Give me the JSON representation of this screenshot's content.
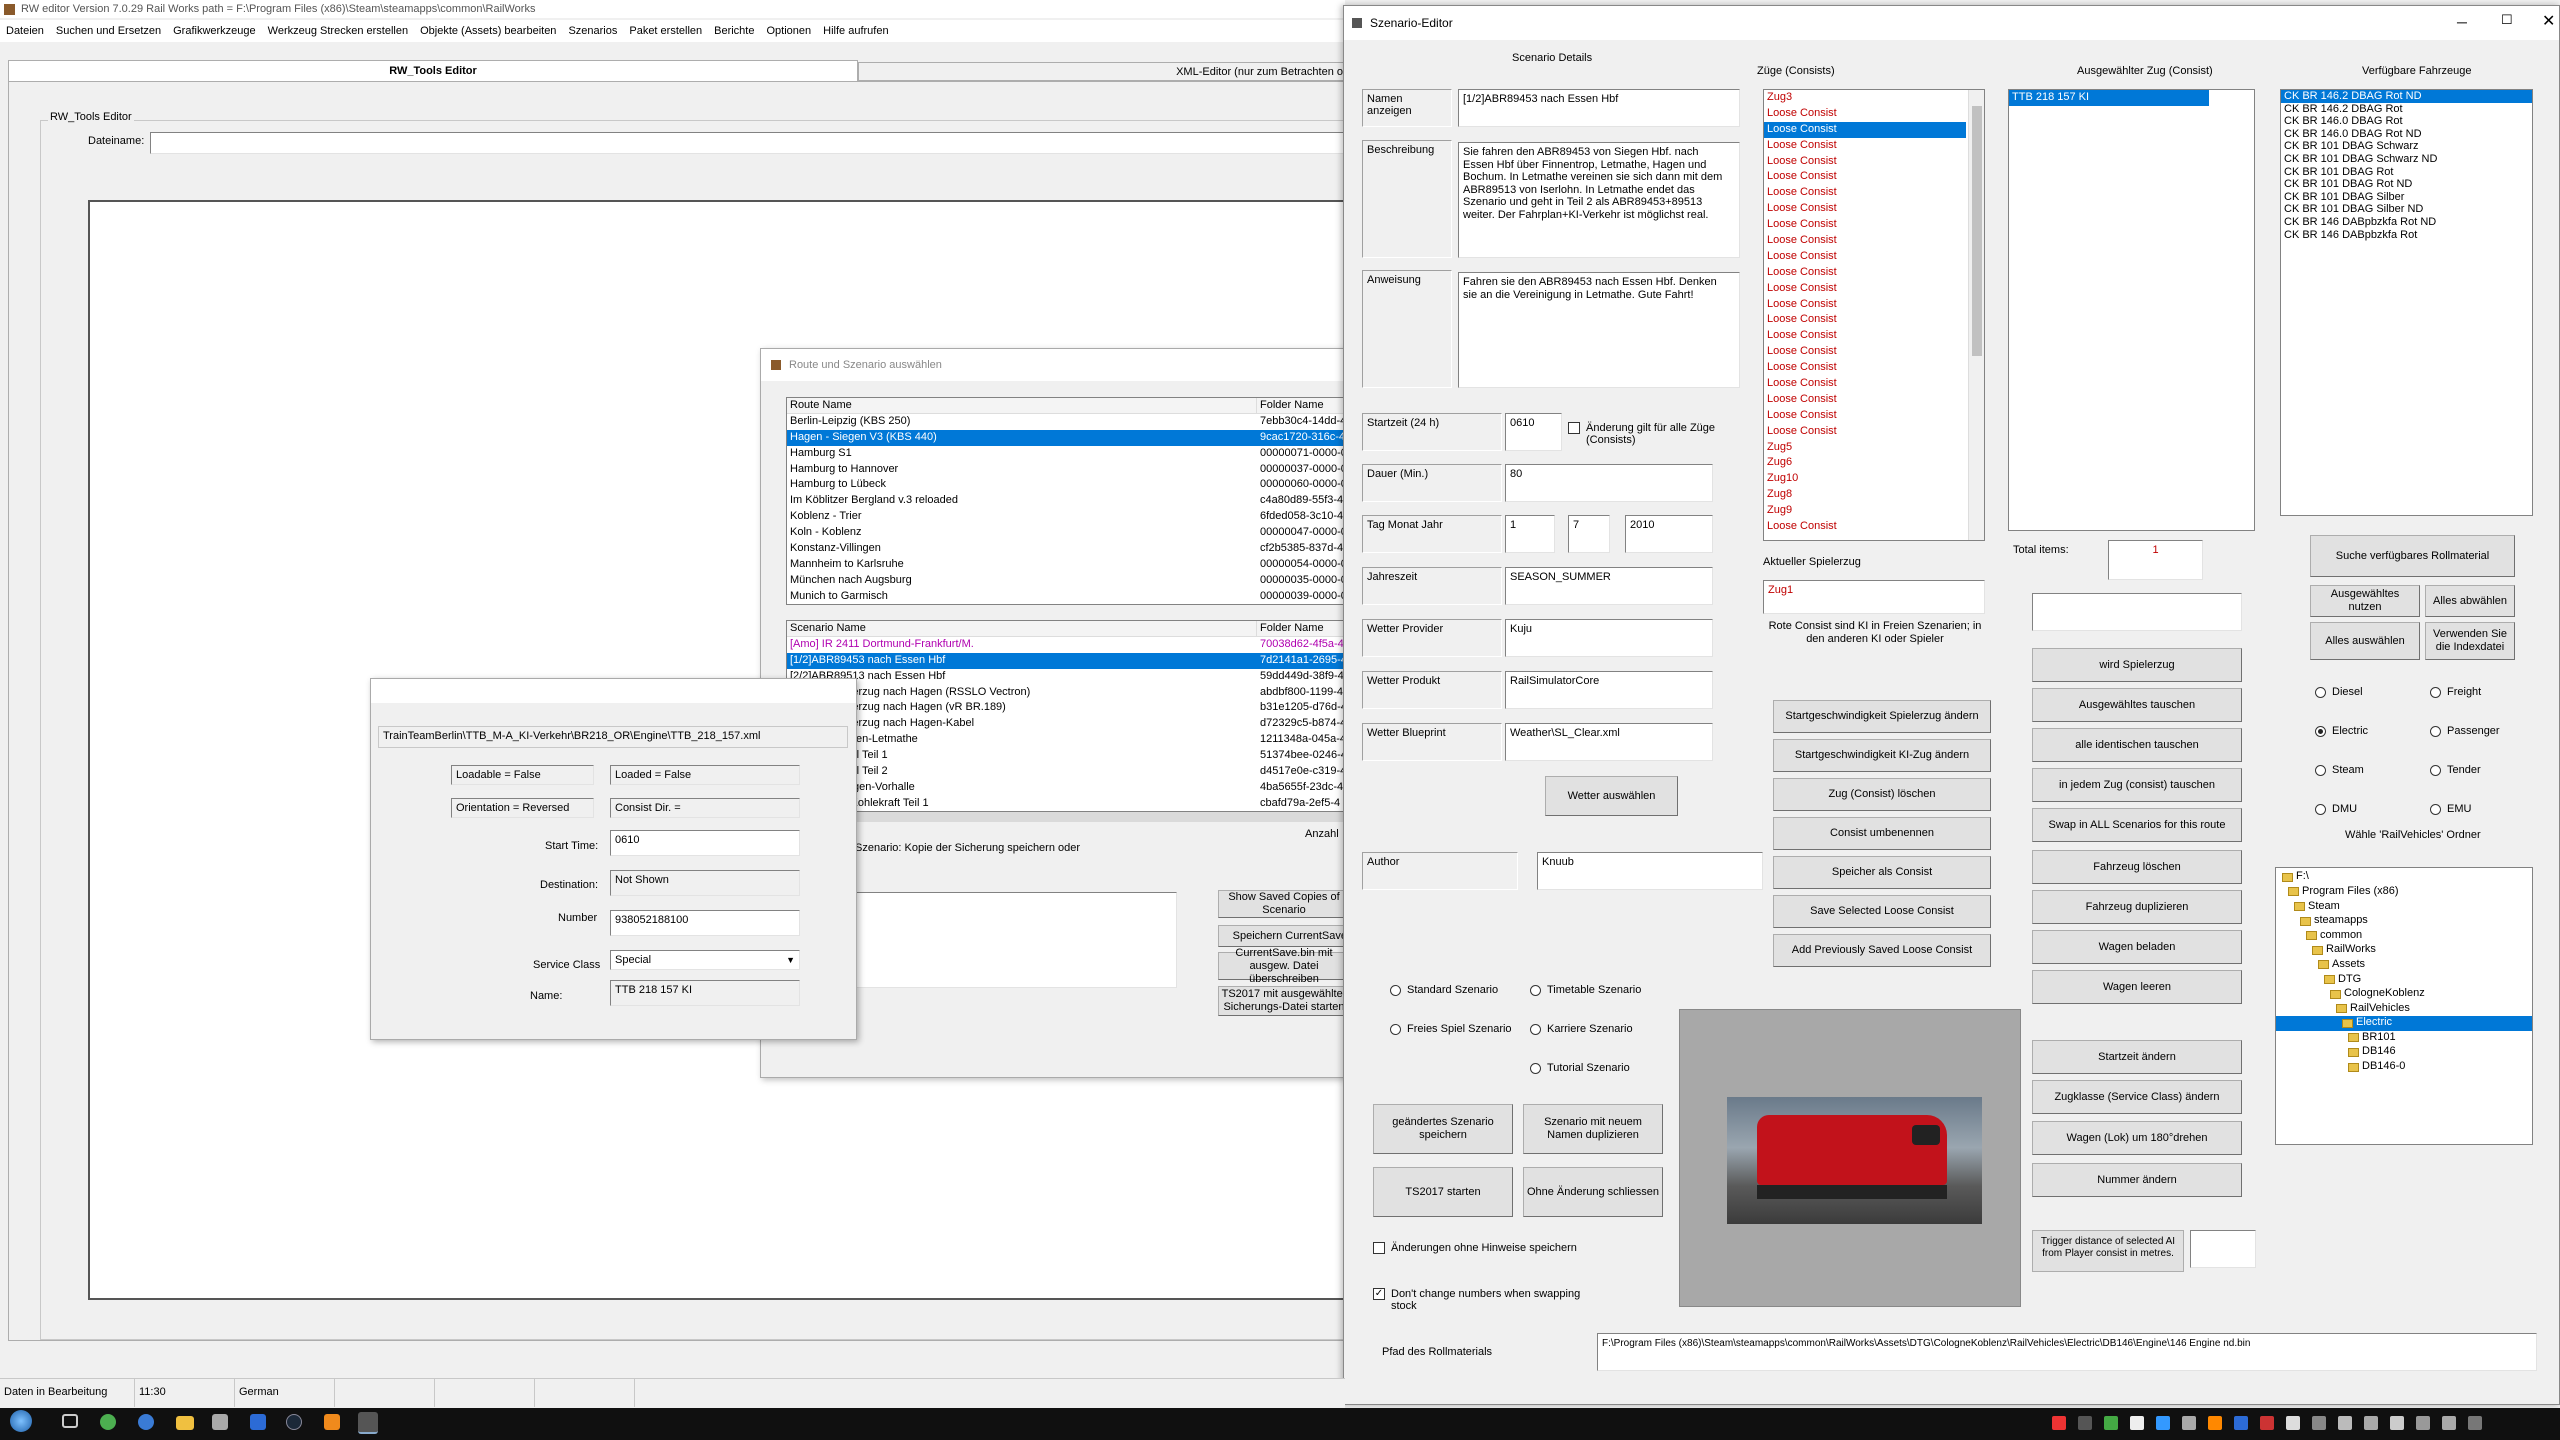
{
  "main": {
    "title": "RW editor  Version 7.0.29   Rail Works path = F:\\Program Files (x86)\\Steam\\steamapps\\common\\RailWorks",
    "menu": [
      "Dateien",
      "Suchen und Ersetzen",
      "Grafikwerkzeuge",
      "Werkzeug Strecken erstellen",
      "Objekte (Assets) bearbeiten",
      "Szenarios",
      "Paket erstellen",
      "Berichte",
      "Optionen",
      "Hilfe aufrufen"
    ],
    "tabs": [
      "RW_Tools Editor",
      "XML-Editor (nur zum Betrachten o"
    ],
    "group_label": "RW_Tools Editor",
    "filename_label": "Dateiname:",
    "filename_value": "",
    "status": [
      "Daten in Bearbeitung",
      "11:30",
      "German"
    ]
  },
  "route_dialog": {
    "title": "Route und Szenario auswählen",
    "route_headers": [
      "Route Name",
      "Folder Name"
    ],
    "routes": [
      [
        "Berlin-Leipzig (KBS 250)",
        "7ebb30c4-14dd-4"
      ],
      [
        "Hagen - Siegen V3 (KBS 440)",
        "9cac1720-316c-4"
      ],
      [
        "Hamburg S1",
        "00000071-0000-0"
      ],
      [
        "Hamburg to Hannover",
        "00000037-0000-0"
      ],
      [
        "Hamburg to Lübeck",
        "00000060-0000-0"
      ],
      [
        "Im Köblitzer Bergland v.3 reloaded",
        "c4a80d89-55f3-4"
      ],
      [
        "Koblenz - Trier",
        "6fded058-3c10-4"
      ],
      [
        "Koln - Koblenz",
        "00000047-0000-0"
      ],
      [
        "Konstanz-Villingen",
        "cf2b5385-837d-4"
      ],
      [
        "Mannheim to Karlsruhe",
        "00000054-0000-0"
      ],
      [
        "München nach Augsburg",
        "00000035-0000-0"
      ],
      [
        "Munich to Garmisch",
        "00000039-0000-0"
      ]
    ],
    "scenario_headers": [
      "Scenario Name",
      "Folder Name"
    ],
    "scenarios": [
      [
        "[Amo] IR 2411 Dortmund-Frankfurt/M.",
        "70038d62-4f5a-4"
      ],
      [
        "[1/2]ABR89453 nach Essen Hbf",
        "7d2141a1-2695-4"
      ],
      [
        "[2/2]ABR89513 nach Essen Hbf",
        "59dd449d-38f9-4"
      ],
      [
        "Leichte Gueterzug nach Hagen (RSSLO Vectron)",
        "abdbf800-1199-4"
      ],
      [
        "Leichte Gueterzug nach Hagen (vR BR.189)",
        "b31e1205-d76d-4"
      ],
      [
        "Leichte Gueterzug nach Hagen-Kabel",
        "d72329c5-b874-4"
      ],
      [
        "Stop RE Siegen-Letmathe",
        "1211348a-045a-4"
      ],
      [
        "Nach Kreuztal Teil 1",
        "51374bee-0246-4"
      ],
      [
        "Nach Kreuztal Teil 2",
        "d4517e0e-c319-4"
      ],
      [
        "Zug nach Hagen-Vorhalle",
        "4ba5655f-23dc-4"
      ],
      [
        "Leichte fuer Kohlekraft Teil 1",
        "cbafd79a-2ef5-4"
      ]
    ],
    "anzahl_label": "Anzahl",
    "save_text": "Szenario: Kopie der Sicherung speichern oder",
    "buttons": [
      "Show Saved Copies of Scenario",
      "Speichern CurrentSave",
      "CurrentSave.bin mit ausgew. Datei überschreiben",
      "TS2017 mit ausgewählter Sicherungs-Datei starten"
    ]
  },
  "consist_dialog": {
    "path": "TrainTeamBerlin\\TTB_M-A_KI-Verkehr\\BR218_OR\\Engine\\TTB_218_157.xml",
    "loadable": "Loadable = False",
    "loaded": "Loaded = False",
    "orientation": "Orientation = Reversed",
    "consist_dir": "Consist Dir. =",
    "start_time_label": "Start Time:",
    "start_time": "0610",
    "destination_label": "Destination:",
    "destination": "Not Shown",
    "number_label": "Number",
    "number": "938052188100",
    "service_label": "Service Class",
    "service": "Special",
    "name_label": "Name:",
    "name": "TTB 218 157 KI"
  },
  "editor": {
    "title": "Szenario-Editor",
    "details_header": "Scenario Details",
    "trains_header": "Züge (Consists)",
    "selected_header": "Ausgewählter Zug (Consist)",
    "vehicles_header": "Verfügbare Fahrzeuge",
    "name_label": "Namen anzeigen",
    "name_value": "[1/2]ABR89453 nach Essen Hbf",
    "desc_label": "Beschreibung",
    "desc_value": "Sie fahren den ABR89453 von Siegen Hbf. nach Essen Hbf über Finnentrop, Letmathe, Hagen und Bochum. In Letmathe vereinen sie sich dann mit dem ABR89513 von Iserlohn. In Letmathe endet das Szenario und geht in Teil 2 als ABR89453+89513 weiter. Der Fahrplan+KI-Verkehr ist möglichst real.",
    "instr_label": "Anweisung",
    "instr_value": "Fahren sie den ABR89453 nach Essen Hbf. Denken sie an die Vereinigung in Letmathe. Gute Fahrt!",
    "start_label": "Startzeit (24 h)",
    "start_value": "0610",
    "change_all": "Änderung gilt für alle Züge (Consists)",
    "duration_label": "Dauer (Min.)",
    "duration_value": "80",
    "date_label": "Tag Monat Jahr",
    "day": "1",
    "month": "7",
    "year": "2010",
    "season_label": "Jahreszeit",
    "season_value": "SEASON_SUMMER",
    "provider_label": "Wetter Provider",
    "provider_value": "Kuju",
    "product_label": "Wetter Produkt",
    "product_value": "RailSimulatorCore",
    "blueprint_label": "Wetter Blueprint",
    "blueprint_value": "Weather\\SL_Clear.xml",
    "weather_btn": "Wetter auswählen",
    "author_label": "Author",
    "author_value": "Knuub",
    "trains": [
      "Zug3",
      "Loose Consist",
      "Loose Consist",
      "Loose Consist",
      "Loose Consist",
      "Loose Consist",
      "Loose Consist",
      "Loose Consist",
      "Loose Consist",
      "Loose Consist",
      "Loose Consist",
      "Loose Consist",
      "Loose Consist",
      "Loose Consist",
      "Loose Consist",
      "Loose Consist",
      "Loose Consist",
      "Loose Consist",
      "Loose Consist",
      "Loose Consist",
      "Loose Consist",
      "Loose Consist",
      "Zug5",
      "Zug6",
      "Zug10",
      "Zug8",
      "Zug9",
      "Loose Consist"
    ],
    "player_label": "Aktueller Spielerzug",
    "player_value": "Zug1",
    "red_note": "Rote Consist sind KI in Freien Szenarien; in den anderen KI oder Spieler",
    "mid_buttons": [
      "Startgeschwindigkeit Spielerzug ändern",
      "Startgeschwindigkeit KI-Zug ändern",
      "Zug (Consist) löschen",
      "Consist umbenennen",
      "Speicher als Consist",
      "Save Selected Loose Consist",
      "Add Previously Saved Loose Consist"
    ],
    "selected_train": [
      "TTB 218 157 KI"
    ],
    "total_label": "Total items:",
    "total_value": "1",
    "search_value": "",
    "right_buttons": [
      "wird Spielerzug",
      "Ausgewähltes tauschen",
      "alle identischen tauschen",
      "in jedem Zug (consist) tauschen",
      "Swap in ALL Scenarios for this route",
      "Fahrzeug löschen",
      "Fahrzeug duplizieren",
      "Wagen beladen",
      "Wagen leeren",
      "Startzeit ändern",
      "Zugklasse (Service Class) ändern",
      "Wagen (Lok) um 180°drehen",
      "Nummer ändern"
    ],
    "trigger_label": "Trigger distance of selected AI from Player consist in metres.",
    "trigger_value": "",
    "vehicles": [
      "CK BR 146.2 DBAG Rot ND",
      "CK BR 146.2 DBAG Rot",
      "CK BR 146.0 DBAG Rot",
      "CK BR 146.0 DBAG Rot ND",
      "CK BR 101 DBAG Schwarz",
      "CK BR 101 DBAG Schwarz ND",
      "CK BR 101 DBAG Rot",
      "CK BR 101 DBAG Rot ND",
      "CK BR 101 DBAG Silber",
      "CK BR 101 DBAG Silber ND",
      "CK BR 146 DABpbzkfa Rot ND",
      "CK BR 146 DABpbzkfa Rot"
    ],
    "far_buttons": [
      "Suche verfügbares Rollmaterial",
      "Ausgewähltes nutzen",
      "Alles abwählen",
      "Alles auswählen",
      "Verwenden Sie die Indexdatei"
    ],
    "types": [
      "Diesel",
      "Freight",
      "Electric",
      "Passenger",
      "Steam",
      "Tender",
      "DMU",
      "EMU"
    ],
    "folder_label": "Wähle 'RailVehicles' Ordner",
    "tree": [
      [
        "F:\\",
        0
      ],
      [
        "Program Files (x86)",
        1
      ],
      [
        "Steam",
        2
      ],
      [
        "steamapps",
        3
      ],
      [
        "common",
        4
      ],
      [
        "RailWorks",
        5
      ],
      [
        "Assets",
        6
      ],
      [
        "DTG",
        7
      ],
      [
        "CologneKoblenz",
        8
      ],
      [
        "RailVehicles",
        9
      ],
      [
        "Electric",
        10
      ],
      [
        "BR101",
        11
      ],
      [
        "DB146",
        11
      ],
      [
        "DB146-0",
        11
      ]
    ],
    "scenario_types": [
      "Standard Szenario",
      "Timetable Szenario",
      "Freies Spiel Szenario",
      "Karriere Szenario",
      "Tutorial Szenario"
    ],
    "bottom_buttons": [
      "geändertes Szenario speichern",
      "Szenario mit neuem Namen duplizieren",
      "TS2017 starten",
      "Ohne Änderung schliessen"
    ],
    "save_no_hint": "Änderungen ohne Hinweise speichern",
    "dont_change": "Don't change numbers when swapping stock",
    "path_label": "Pfad des Rollmaterials",
    "path_value": "F:\\Program Files (x86)\\Steam\\steamapps\\common\\RailWorks\\Assets\\DTG\\CologneKoblenz\\RailVehicles\\Electric\\DB146\\Engine\\146 Engine nd.bin"
  },
  "colors": {
    "select": "#0078d7",
    "red_text": "#c00000",
    "taskbar": "#101010"
  }
}
